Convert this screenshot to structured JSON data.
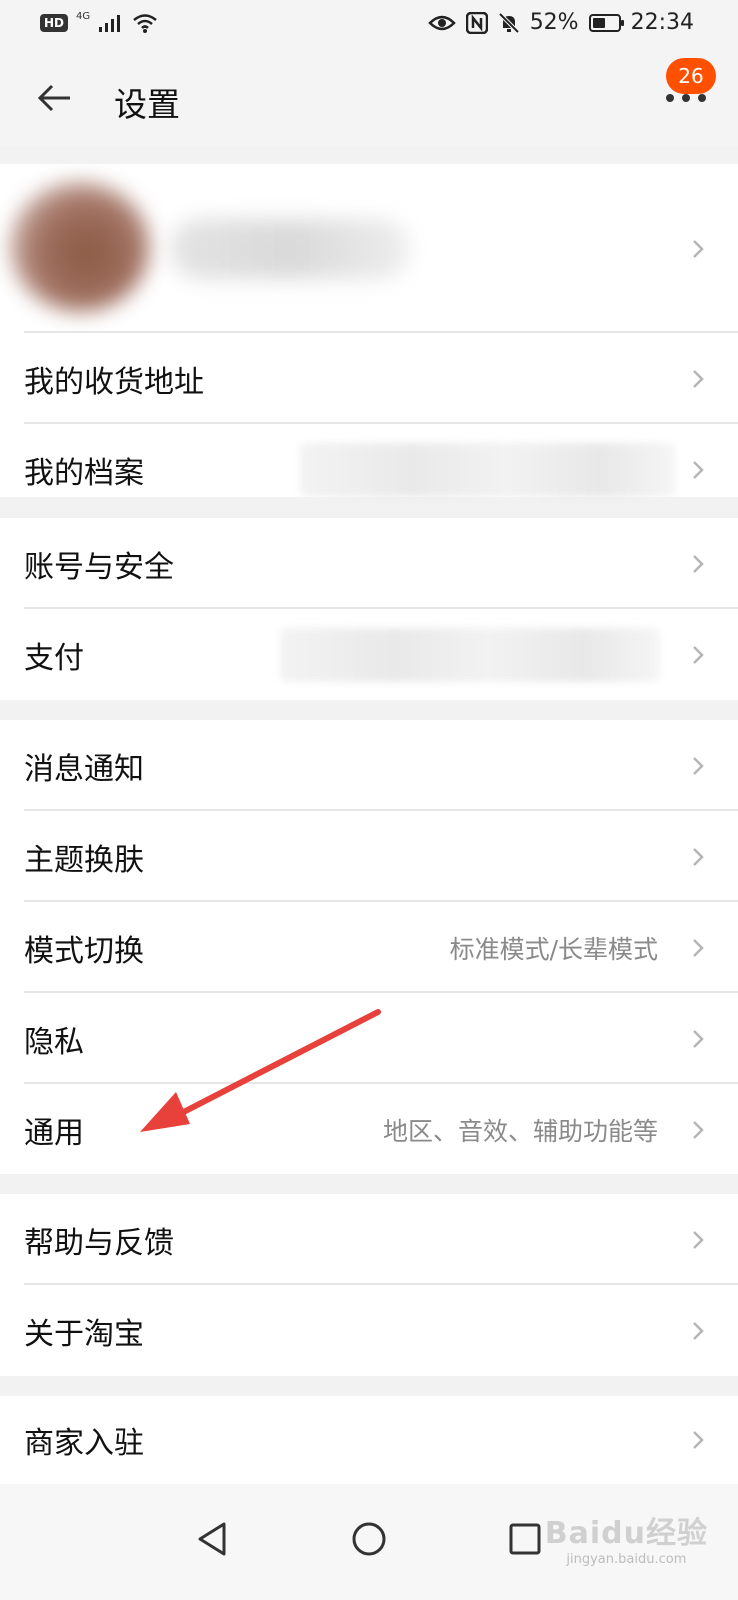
{
  "status_bar": {
    "hd": "HD",
    "network": "4G",
    "battery_percent": "52%",
    "battery_level": 0.52,
    "time": "22:34",
    "icons": [
      "signal-icon",
      "wifi-icon",
      "eye-icon",
      "nfc-icon",
      "bell-off-icon",
      "battery-icon"
    ]
  },
  "header": {
    "title": "设置",
    "badge_count": "26"
  },
  "groups": [
    {
      "items": [
        {
          "label": "我的收货地址",
          "value": ""
        },
        {
          "label": "我的档案",
          "value": ""
        }
      ]
    },
    {
      "items": [
        {
          "label": "账号与安全",
          "value": ""
        },
        {
          "label": "支付",
          "value": ""
        }
      ]
    },
    {
      "items": [
        {
          "label": "消息通知",
          "value": ""
        },
        {
          "label": "主题换肤",
          "value": ""
        },
        {
          "label": "模式切换",
          "value": "标准模式/长辈模式"
        },
        {
          "label": "隐私",
          "value": ""
        },
        {
          "label": "通用",
          "value": "地区、音效、辅助功能等"
        }
      ]
    },
    {
      "items": [
        {
          "label": "帮助与反馈",
          "value": ""
        },
        {
          "label": "关于淘宝",
          "value": ""
        }
      ]
    },
    {
      "items": [
        {
          "label": "商家入驻",
          "value": ""
        }
      ]
    }
  ],
  "watermark": {
    "main": "Baidu经验",
    "sub": "jingyan.baidu.com"
  },
  "colors": {
    "accent_badge": "#ff5000",
    "annotation_arrow": "#e8403a",
    "background": "#f2f2f2",
    "card": "#ffffff"
  }
}
